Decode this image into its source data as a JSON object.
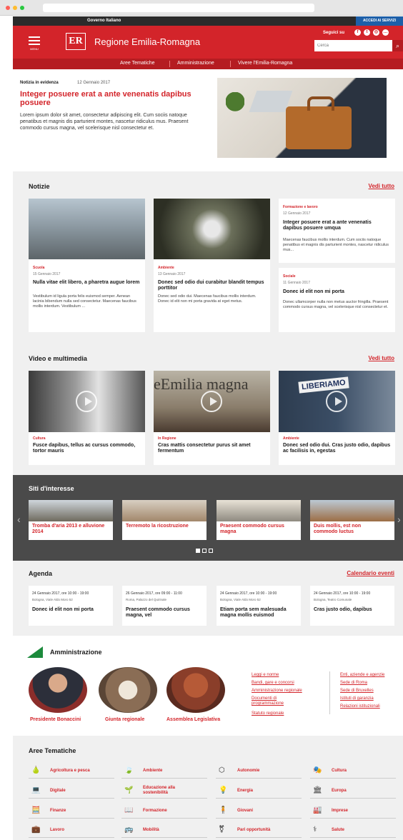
{
  "gov": {
    "title": "Governo Italiano",
    "access": "ACCEDI AI SERVIZI"
  },
  "header": {
    "menu_label": "MENU",
    "logo": "ER",
    "brand": "Regione Emilia-Romagna",
    "follow": "Seguici su",
    "search_placeholder": "Cerca"
  },
  "nav": {
    "items": [
      "Aree Tematiche",
      "Amministrazione",
      "Vivere l'Emilia-Romagna"
    ]
  },
  "hero": {
    "kicker": "Notizia in evidenza",
    "date": "12 Gennaio 2017",
    "title": "Integer posuere erat a ante venenatis dapibus posuere",
    "text": "Lorem ipsum dolor sit amet, consectetur adipiscing elit. Cum sociis natoque penatibus et magnis dis parturient montes, nascetur ridiculus mus. Praesent commodo cursus magna, vel scelerisque nisl consectetur et."
  },
  "notizie": {
    "title": "Notizie",
    "more": "Vedi tutto",
    "cards": [
      {
        "cat": "Scuola",
        "date": "15 Gennaio 2017",
        "title": "Nulla vitae elit libero, a pharetra augue lorem",
        "text": "Vestibulum id ligula porta felis euismod semper. Aenean lacinia bibendum nulla sed consectetur. Maecenas faucibus mollis interdum. Vestibulum ..."
      },
      {
        "cat": "Ambiente",
        "date": "13 Gennaio 2017",
        "title": "Donec sed odio dui curabitur blandit tempus porttitor",
        "text": "Donec sed odio dui. Maecenas faucibus mollis interdum. Donec id elit non mi porta gravida at eget metus."
      },
      {
        "cat": "Formazione e lavoro",
        "date": "12 Gennaio 2017",
        "title": "Integer posuere erat a ante venenatis dapibus posuere umqua",
        "text": "Maecenas faucibus mollis interdum. Cum sociis natoque penatibus et magnis dis parturient montes, nascetur ridiculus mus..."
      },
      {
        "cat": "Sociale",
        "date": "11 Gennaio 2017",
        "title": "Donec id elit non mi porta",
        "text": "Donec ullamcorper nulla non metus auctor fringilla. Praesent commodo cursus magna, vel scelerisque nisl consectetur et."
      }
    ]
  },
  "video": {
    "title": "Video e multimedia",
    "more": "Vedi tutto",
    "cards": [
      {
        "cat": "Cultura",
        "title": "Fusce dapibus, tellus ac cursus commodo, tortor mauris"
      },
      {
        "cat": "In Regione",
        "title": "Cras mattis consectetur purus sit amet fermentum",
        "img_text": "eEmilia magna"
      },
      {
        "cat": "Ambiente",
        "title": "Donec sed odio dui. Cras justo odio, dapibus ac facilisis in, egestas",
        "img_text": "LIBERIAMO"
      }
    ]
  },
  "siti": {
    "title": "Siti d'interesse",
    "items": [
      "Tromba d'aria 2013 e alluvione 2014",
      "Terremoto la ricostruzione",
      "Praesent commodo cursus magna",
      "Duis mollis, est non commodo luctus"
    ]
  },
  "agenda": {
    "title": "Agenda",
    "more": "Calendario eventi",
    "items": [
      {
        "date": "24 Gennaio 2017, ore 10:00 - 19:00",
        "loc": "Bologna, Viale Aldo Moro 52",
        "title": "Donec id elit non mi porta"
      },
      {
        "date": "26 Gennaio 2017, ore 09:00 - 11:00",
        "loc": "Roma, Palazzo del Quirinale",
        "title": "Praesent commodo cursus magna, vel"
      },
      {
        "date": "24 Gennaio 2017, ore 10:00 - 19:00",
        "loc": "Bologna, Viale Aldo Moro 52",
        "title": "Etiam porta sem malesuada magna mollis euismod"
      },
      {
        "date": "24 Gennaio 2017, ore 10:00 - 19:00",
        "loc": "Bologna, Teatro Comunale",
        "title": "Cras justo odio, dapibus"
      }
    ]
  },
  "amministrazione": {
    "title": "Amministrazione",
    "people": [
      "Presidente Bonaccini",
      "Giunta regionale",
      "Assemblea Legislativa"
    ],
    "links_left": [
      "Leggi e norme",
      "Bandi, gare e concorsi",
      "Amministrazione regionale",
      "Documenti di programmazione",
      "Statuto regionale"
    ],
    "links_right": [
      "Enti, aziende e agenzie",
      "Sede di Roma",
      "Sede di Bruxelles",
      "Istituti di garanzia",
      "Relazioni istituzionali"
    ]
  },
  "aree": {
    "title": "Aree Tematiche",
    "items": [
      {
        "label": "Agricoltura e pesca",
        "icon": "🍐"
      },
      {
        "label": "Ambiente",
        "icon": "🍃"
      },
      {
        "label": "Autonomie",
        "icon": "⬡"
      },
      {
        "label": "Cultura",
        "icon": "🎭"
      },
      {
        "label": "Digitale",
        "icon": "💻"
      },
      {
        "label": "Educazione alla sostenibilità",
        "icon": "🌱"
      },
      {
        "label": "Energia",
        "icon": "💡"
      },
      {
        "label": "Europa",
        "icon": "🏛"
      },
      {
        "label": "Finanze",
        "icon": "🧮"
      },
      {
        "label": "Formazione",
        "icon": "📖"
      },
      {
        "label": "Giovani",
        "icon": "🧍"
      },
      {
        "label": "Imprese",
        "icon": "🏭"
      },
      {
        "label": "Lavoro",
        "icon": "💼"
      },
      {
        "label": "Mobilità",
        "icon": "🚌"
      },
      {
        "label": "Pari opportunità",
        "icon": "⚧"
      },
      {
        "label": "Salute",
        "icon": "⚕"
      }
    ]
  },
  "colors": {
    "brand_red": "#d3242a",
    "dark_red": "#b51c21",
    "dark_gray": "#4a4a4a",
    "gov_blue": "#1d5fa8"
  }
}
